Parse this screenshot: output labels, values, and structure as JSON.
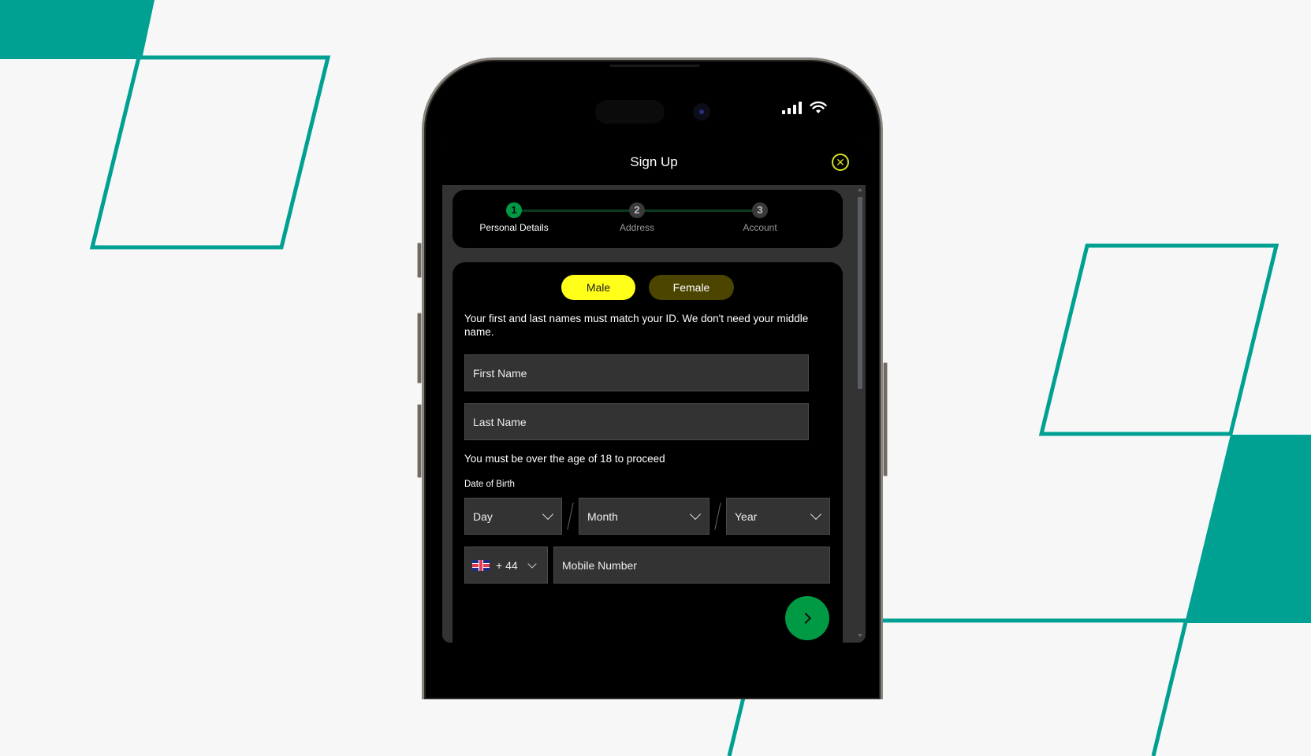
{
  "colors": {
    "background": "#f7f7f7",
    "teal_accent": "#00a093",
    "brand_green": "#009a44",
    "highlight_yellow": "#ffff1a",
    "close_yellow": "#d7df23"
  },
  "status_bar": {
    "signal_icon": "cellular-signal-icon",
    "wifi_icon": "wifi-icon"
  },
  "modal": {
    "title": "Sign Up",
    "close_icon": "close-circle-icon",
    "close_glyph": "✕"
  },
  "stepper": {
    "current_step": 1,
    "steps": [
      {
        "number": "1",
        "label": "Personal Details"
      },
      {
        "number": "2",
        "label": "Address"
      },
      {
        "number": "3",
        "label": "Account"
      }
    ]
  },
  "form": {
    "gender": {
      "options": [
        "Male",
        "Female"
      ],
      "selected": "Male"
    },
    "name_notice": "Your first and last names must match your ID. We don't need your middle name.",
    "first_name": {
      "placeholder": "First Name",
      "value": ""
    },
    "last_name": {
      "placeholder": "Last Name",
      "value": ""
    },
    "age_notice": "You must be over the age of 18 to proceed",
    "dob": {
      "label": "Date of Birth",
      "day": "Day",
      "month": "Month",
      "year": "Year",
      "separator": "/"
    },
    "phone": {
      "country_flag": "uk-flag-icon",
      "dial_code": "+ 44",
      "placeholder": "Mobile Number",
      "value": ""
    },
    "next_icon": "chevron-right-icon"
  }
}
